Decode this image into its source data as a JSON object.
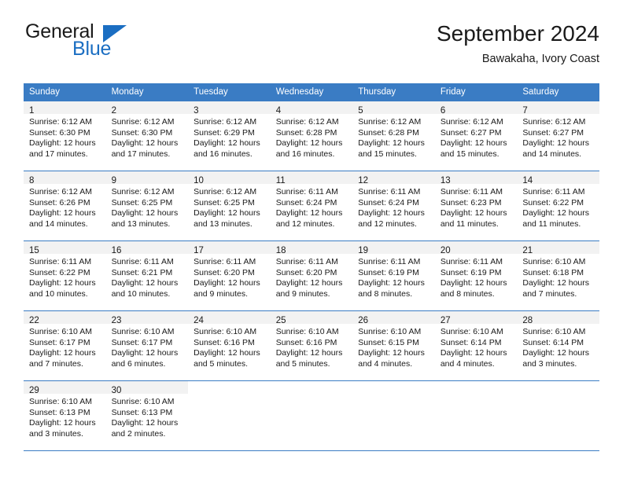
{
  "brand": {
    "name_top": "General",
    "name_bottom": "Blue",
    "color_dark": "#1a1a1a",
    "color_blue": "#1b6ec2"
  },
  "header": {
    "title": "September 2024",
    "subtitle": "Bawakaha, Ivory Coast"
  },
  "calendar": {
    "header_bg": "#3a7cc4",
    "daynum_bg": "#f2f2f2",
    "weekday_headers": [
      "Sunday",
      "Monday",
      "Tuesday",
      "Wednesday",
      "Thursday",
      "Friday",
      "Saturday"
    ],
    "weeks": [
      [
        {
          "day": "1",
          "sunrise": "Sunrise: 6:12 AM",
          "sunset": "Sunset: 6:30 PM",
          "daylight1": "Daylight: 12 hours",
          "daylight2": "and 17 minutes."
        },
        {
          "day": "2",
          "sunrise": "Sunrise: 6:12 AM",
          "sunset": "Sunset: 6:30 PM",
          "daylight1": "Daylight: 12 hours",
          "daylight2": "and 17 minutes."
        },
        {
          "day": "3",
          "sunrise": "Sunrise: 6:12 AM",
          "sunset": "Sunset: 6:29 PM",
          "daylight1": "Daylight: 12 hours",
          "daylight2": "and 16 minutes."
        },
        {
          "day": "4",
          "sunrise": "Sunrise: 6:12 AM",
          "sunset": "Sunset: 6:28 PM",
          "daylight1": "Daylight: 12 hours",
          "daylight2": "and 16 minutes."
        },
        {
          "day": "5",
          "sunrise": "Sunrise: 6:12 AM",
          "sunset": "Sunset: 6:28 PM",
          "daylight1": "Daylight: 12 hours",
          "daylight2": "and 15 minutes."
        },
        {
          "day": "6",
          "sunrise": "Sunrise: 6:12 AM",
          "sunset": "Sunset: 6:27 PM",
          "daylight1": "Daylight: 12 hours",
          "daylight2": "and 15 minutes."
        },
        {
          "day": "7",
          "sunrise": "Sunrise: 6:12 AM",
          "sunset": "Sunset: 6:27 PM",
          "daylight1": "Daylight: 12 hours",
          "daylight2": "and 14 minutes."
        }
      ],
      [
        {
          "day": "8",
          "sunrise": "Sunrise: 6:12 AM",
          "sunset": "Sunset: 6:26 PM",
          "daylight1": "Daylight: 12 hours",
          "daylight2": "and 14 minutes."
        },
        {
          "day": "9",
          "sunrise": "Sunrise: 6:12 AM",
          "sunset": "Sunset: 6:25 PM",
          "daylight1": "Daylight: 12 hours",
          "daylight2": "and 13 minutes."
        },
        {
          "day": "10",
          "sunrise": "Sunrise: 6:12 AM",
          "sunset": "Sunset: 6:25 PM",
          "daylight1": "Daylight: 12 hours",
          "daylight2": "and 13 minutes."
        },
        {
          "day": "11",
          "sunrise": "Sunrise: 6:11 AM",
          "sunset": "Sunset: 6:24 PM",
          "daylight1": "Daylight: 12 hours",
          "daylight2": "and 12 minutes."
        },
        {
          "day": "12",
          "sunrise": "Sunrise: 6:11 AM",
          "sunset": "Sunset: 6:24 PM",
          "daylight1": "Daylight: 12 hours",
          "daylight2": "and 12 minutes."
        },
        {
          "day": "13",
          "sunrise": "Sunrise: 6:11 AM",
          "sunset": "Sunset: 6:23 PM",
          "daylight1": "Daylight: 12 hours",
          "daylight2": "and 11 minutes."
        },
        {
          "day": "14",
          "sunrise": "Sunrise: 6:11 AM",
          "sunset": "Sunset: 6:22 PM",
          "daylight1": "Daylight: 12 hours",
          "daylight2": "and 11 minutes."
        }
      ],
      [
        {
          "day": "15",
          "sunrise": "Sunrise: 6:11 AM",
          "sunset": "Sunset: 6:22 PM",
          "daylight1": "Daylight: 12 hours",
          "daylight2": "and 10 minutes."
        },
        {
          "day": "16",
          "sunrise": "Sunrise: 6:11 AM",
          "sunset": "Sunset: 6:21 PM",
          "daylight1": "Daylight: 12 hours",
          "daylight2": "and 10 minutes."
        },
        {
          "day": "17",
          "sunrise": "Sunrise: 6:11 AM",
          "sunset": "Sunset: 6:20 PM",
          "daylight1": "Daylight: 12 hours",
          "daylight2": "and 9 minutes."
        },
        {
          "day": "18",
          "sunrise": "Sunrise: 6:11 AM",
          "sunset": "Sunset: 6:20 PM",
          "daylight1": "Daylight: 12 hours",
          "daylight2": "and 9 minutes."
        },
        {
          "day": "19",
          "sunrise": "Sunrise: 6:11 AM",
          "sunset": "Sunset: 6:19 PM",
          "daylight1": "Daylight: 12 hours",
          "daylight2": "and 8 minutes."
        },
        {
          "day": "20",
          "sunrise": "Sunrise: 6:11 AM",
          "sunset": "Sunset: 6:19 PM",
          "daylight1": "Daylight: 12 hours",
          "daylight2": "and 8 minutes."
        },
        {
          "day": "21",
          "sunrise": "Sunrise: 6:10 AM",
          "sunset": "Sunset: 6:18 PM",
          "daylight1": "Daylight: 12 hours",
          "daylight2": "and 7 minutes."
        }
      ],
      [
        {
          "day": "22",
          "sunrise": "Sunrise: 6:10 AM",
          "sunset": "Sunset: 6:17 PM",
          "daylight1": "Daylight: 12 hours",
          "daylight2": "and 7 minutes."
        },
        {
          "day": "23",
          "sunrise": "Sunrise: 6:10 AM",
          "sunset": "Sunset: 6:17 PM",
          "daylight1": "Daylight: 12 hours",
          "daylight2": "and 6 minutes."
        },
        {
          "day": "24",
          "sunrise": "Sunrise: 6:10 AM",
          "sunset": "Sunset: 6:16 PM",
          "daylight1": "Daylight: 12 hours",
          "daylight2": "and 5 minutes."
        },
        {
          "day": "25",
          "sunrise": "Sunrise: 6:10 AM",
          "sunset": "Sunset: 6:16 PM",
          "daylight1": "Daylight: 12 hours",
          "daylight2": "and 5 minutes."
        },
        {
          "day": "26",
          "sunrise": "Sunrise: 6:10 AM",
          "sunset": "Sunset: 6:15 PM",
          "daylight1": "Daylight: 12 hours",
          "daylight2": "and 4 minutes."
        },
        {
          "day": "27",
          "sunrise": "Sunrise: 6:10 AM",
          "sunset": "Sunset: 6:14 PM",
          "daylight1": "Daylight: 12 hours",
          "daylight2": "and 4 minutes."
        },
        {
          "day": "28",
          "sunrise": "Sunrise: 6:10 AM",
          "sunset": "Sunset: 6:14 PM",
          "daylight1": "Daylight: 12 hours",
          "daylight2": "and 3 minutes."
        }
      ],
      [
        {
          "day": "29",
          "sunrise": "Sunrise: 6:10 AM",
          "sunset": "Sunset: 6:13 PM",
          "daylight1": "Daylight: 12 hours",
          "daylight2": "and 3 minutes."
        },
        {
          "day": "30",
          "sunrise": "Sunrise: 6:10 AM",
          "sunset": "Sunset: 6:13 PM",
          "daylight1": "Daylight: 12 hours",
          "daylight2": "and 2 minutes."
        },
        {
          "day": "",
          "sunrise": "",
          "sunset": "",
          "daylight1": "",
          "daylight2": ""
        },
        {
          "day": "",
          "sunrise": "",
          "sunset": "",
          "daylight1": "",
          "daylight2": ""
        },
        {
          "day": "",
          "sunrise": "",
          "sunset": "",
          "daylight1": "",
          "daylight2": ""
        },
        {
          "day": "",
          "sunrise": "",
          "sunset": "",
          "daylight1": "",
          "daylight2": ""
        },
        {
          "day": "",
          "sunrise": "",
          "sunset": "",
          "daylight1": "",
          "daylight2": ""
        }
      ]
    ]
  }
}
